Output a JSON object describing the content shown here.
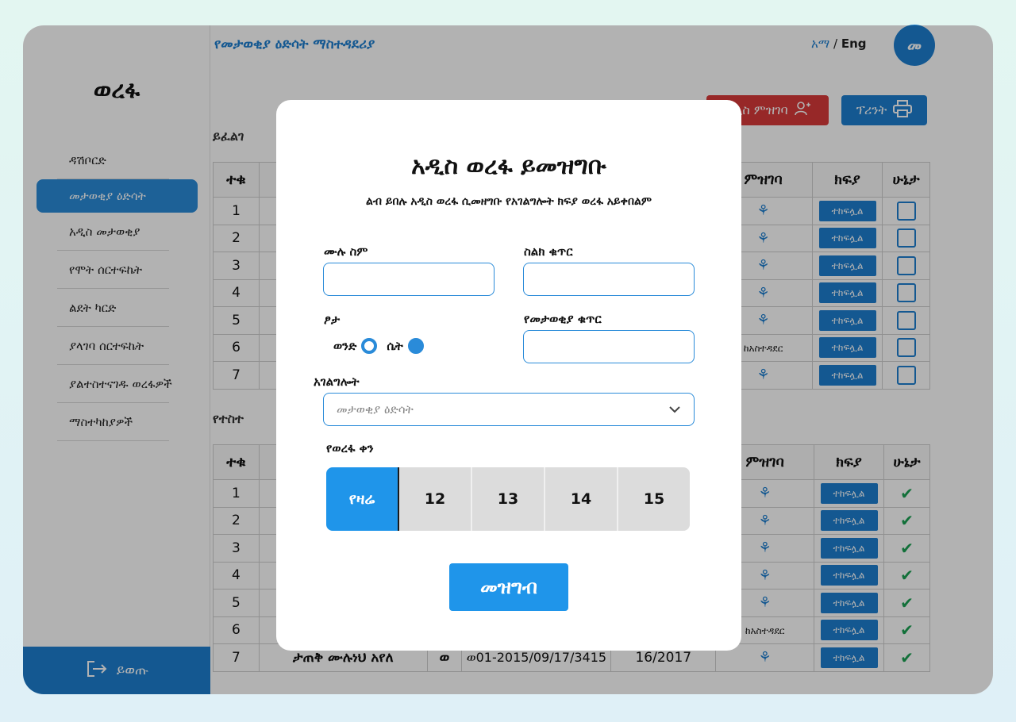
{
  "app": {
    "logo": "ወረፋ",
    "page_title": "የመታወቂያ ዕድሳት ማስተዳደሪያ",
    "lang_am": "አማ",
    "lang_sep": " / ",
    "lang_en": "Eng",
    "avatar": "መ"
  },
  "sidebar": {
    "items": [
      {
        "label": "ዳሽቦርድ"
      },
      {
        "label": "መታወቂያ ዕድሳት"
      },
      {
        "label": "አዲስ መታወቂያ"
      },
      {
        "label": "የሞት ሰርተፍኬት"
      },
      {
        "label": "ልደት ካርድ"
      },
      {
        "label": "ያላገባ ሰርተፍኬት"
      },
      {
        "label": "ያልተስተናገዱ ወረፋዎች"
      },
      {
        "label": "ማስተካከያዎች"
      }
    ],
    "logout": "ይወጡ"
  },
  "toolbar": {
    "section1_title": "ይፈልገ",
    "section2_title": "የተስተ",
    "register_label": "አዲስ ምዝገባ",
    "print_label": "ፕሪንት"
  },
  "table_headers": [
    "ተቁ",
    "ምዝገባ",
    "ክፍያ",
    "ሁኔታ"
  ],
  "table1": {
    "rows": [
      {
        "n": "1",
        "reg": "",
        "pay": "ተከፍሏል"
      },
      {
        "n": "2",
        "reg": "",
        "pay": "ተከፍሏል"
      },
      {
        "n": "3",
        "reg": "",
        "pay": "ተከፍሏል"
      },
      {
        "n": "4",
        "reg": "",
        "pay": "ተከፍሏል"
      },
      {
        "n": "5",
        "reg": "",
        "pay": "ተከፍሏል"
      },
      {
        "n": "6",
        "reg": "ከአስተዳደር",
        "pay": "ተከፍሏል"
      },
      {
        "n": "7",
        "reg": "",
        "pay": "ተከፍሏል"
      }
    ]
  },
  "table2": {
    "rows": [
      {
        "n": "1",
        "name": "",
        "g": "",
        "id": "",
        "date": "",
        "reg": "",
        "pay": "ተከፍሏል"
      },
      {
        "n": "2",
        "name": "",
        "g": "",
        "id": "",
        "date": "",
        "reg": "",
        "pay": "ተከፍሏል"
      },
      {
        "n": "3",
        "name": "",
        "g": "",
        "id": "",
        "date": "",
        "reg": "",
        "pay": "ተከፍሏል"
      },
      {
        "n": "4",
        "name": "",
        "g": "",
        "id": "",
        "date": "",
        "reg": "",
        "pay": "ተከፍሏል"
      },
      {
        "n": "5",
        "name": "",
        "g": "",
        "id": "",
        "date": "",
        "reg": "",
        "pay": "ተከፍሏል"
      },
      {
        "n": "6",
        "name": "",
        "g": "",
        "id": "",
        "date": "",
        "reg": "ከአስተዳደር",
        "pay": "ተከፍሏል"
      },
      {
        "n": "7",
        "name": "ታጠቅ ሙሉነህ አየለ",
        "g": "ወ",
        "id": "ወ01-2015/09/17/3415",
        "date": "16/2017",
        "reg": "",
        "pay": "ተከፍሏል"
      }
    ]
  },
  "modal": {
    "title": "አዲስ ወረፋ ይመዝግቡ",
    "subtitle": "ልብ ይበሉ አዲስ ወረፋ ሲመዘግቡ የአገልግሎት ክፍያ ወረፋ አይቀበልም",
    "full_name_label": "ሙሉ ስም",
    "full_name_value": "",
    "phone_label": "ስልክ ቁጥር",
    "phone_value": "",
    "gender_label": "ፆታ",
    "gender_male": "ወንድ",
    "gender_female": "ሴት",
    "id_number_label": "የመታወቂያ ቁጥር",
    "id_number_value": "",
    "service_label": "አገልግሎት",
    "service_selected": "መታወቂያ ዕድሳት",
    "date_label": "የወረፋ ቀን",
    "dates": [
      "የዛሬ",
      "12",
      "13",
      "14",
      "15"
    ],
    "submit_label": "መዝግብ"
  },
  "colors": {
    "accent": "#1d7fd0",
    "accent_light": "#1f95ea",
    "danger": "#d93a3a",
    "success": "#1aa152"
  }
}
